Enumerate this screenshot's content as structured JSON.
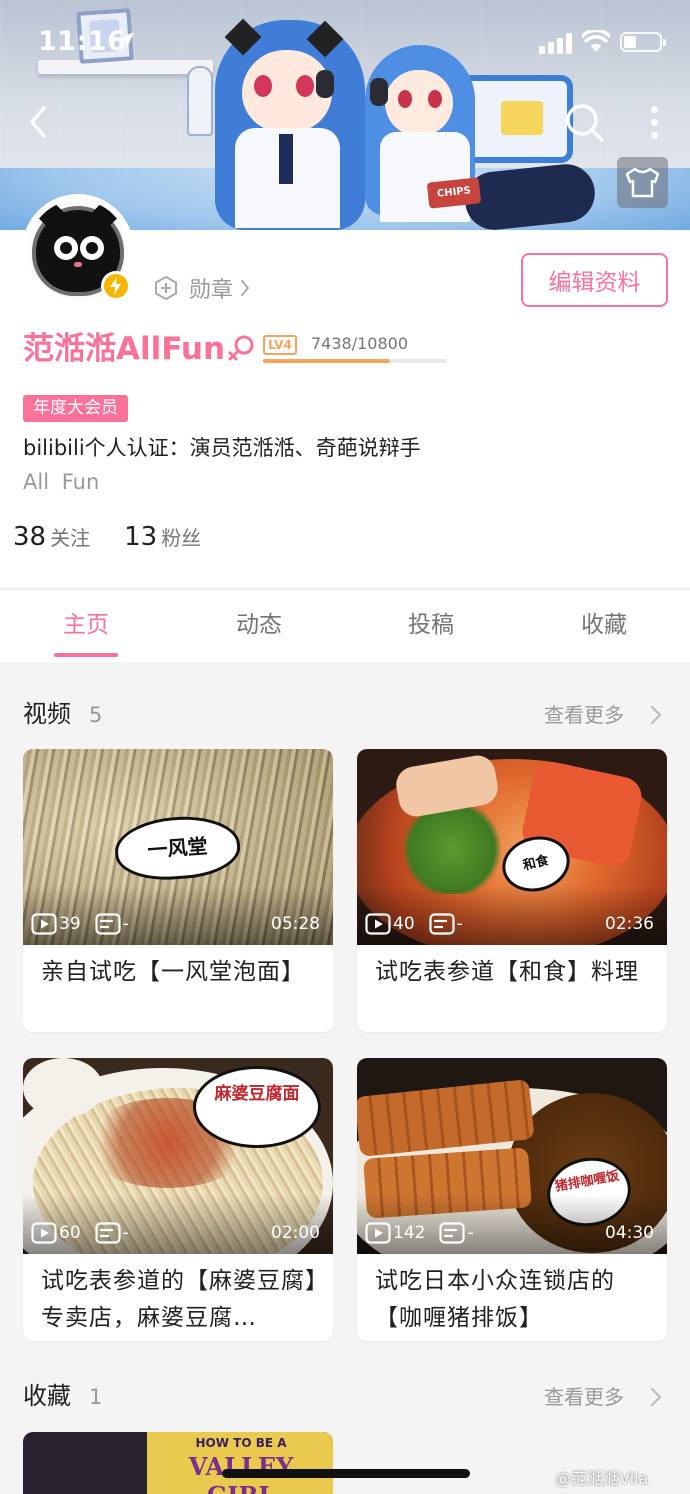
{
  "status_bar": {
    "time": "11:16"
  },
  "profile": {
    "medal_label": "勋章",
    "edit_button": "编辑资料",
    "username": "范湉湉AllFun",
    "level": "LV4",
    "exp": "7438/10800",
    "exp_progress": 0.689,
    "vip_tag": "年度大会员",
    "certification": "bilibili个人认证：演员范湉湉、奇葩说辩手",
    "signature": "All Fun",
    "following_count": "38",
    "following_label": "关注",
    "followers_count": "13",
    "followers_label": "粉丝"
  },
  "tabs": [
    {
      "label": "主页",
      "active": true
    },
    {
      "label": "动态",
      "active": false
    },
    {
      "label": "投稿",
      "active": false
    },
    {
      "label": "收藏",
      "active": false
    }
  ],
  "videos_section": {
    "title": "视频",
    "count": "5",
    "more": "查看更多",
    "items": [
      {
        "title": "亲自试吃【一风堂泡面】",
        "plays": "39",
        "danmaku": "-",
        "duration": "05:28",
        "bubble": "一风堂"
      },
      {
        "title": "试吃表参道【和食】料理",
        "plays": "40",
        "danmaku": "-",
        "duration": "02:36",
        "bubble": "和食"
      },
      {
        "title": "试吃表参道的【麻婆豆腐】专卖店，麻婆豆腐…",
        "plays": "60",
        "danmaku": "-",
        "duration": "02:00",
        "bubble": "麻婆豆腐面"
      },
      {
        "title": "试吃日本小众连锁店的【咖喱猪排饭】",
        "plays": "142",
        "danmaku": "-",
        "duration": "04:30",
        "bubble": "猪排咖喱饭"
      }
    ]
  },
  "favorites_section": {
    "title": "收藏",
    "count": "1",
    "more": "查看更多",
    "cover_text_1": "HOW TO BE A",
    "cover_text_2": "VALLEY GIRL"
  },
  "watermark": "@范湉湉Vila",
  "colors": {
    "accent": "#fb7299",
    "level": "#f5a45c",
    "vip_badge": "#f7b500"
  },
  "icons": {
    "location": "location-arrow-icon",
    "back": "chevron-left-icon",
    "search": "search-icon",
    "more": "more-vertical-icon",
    "theme": "tshirt-icon",
    "gender": "female-icon",
    "play": "play-count-icon",
    "danmaku": "danmaku-icon"
  }
}
